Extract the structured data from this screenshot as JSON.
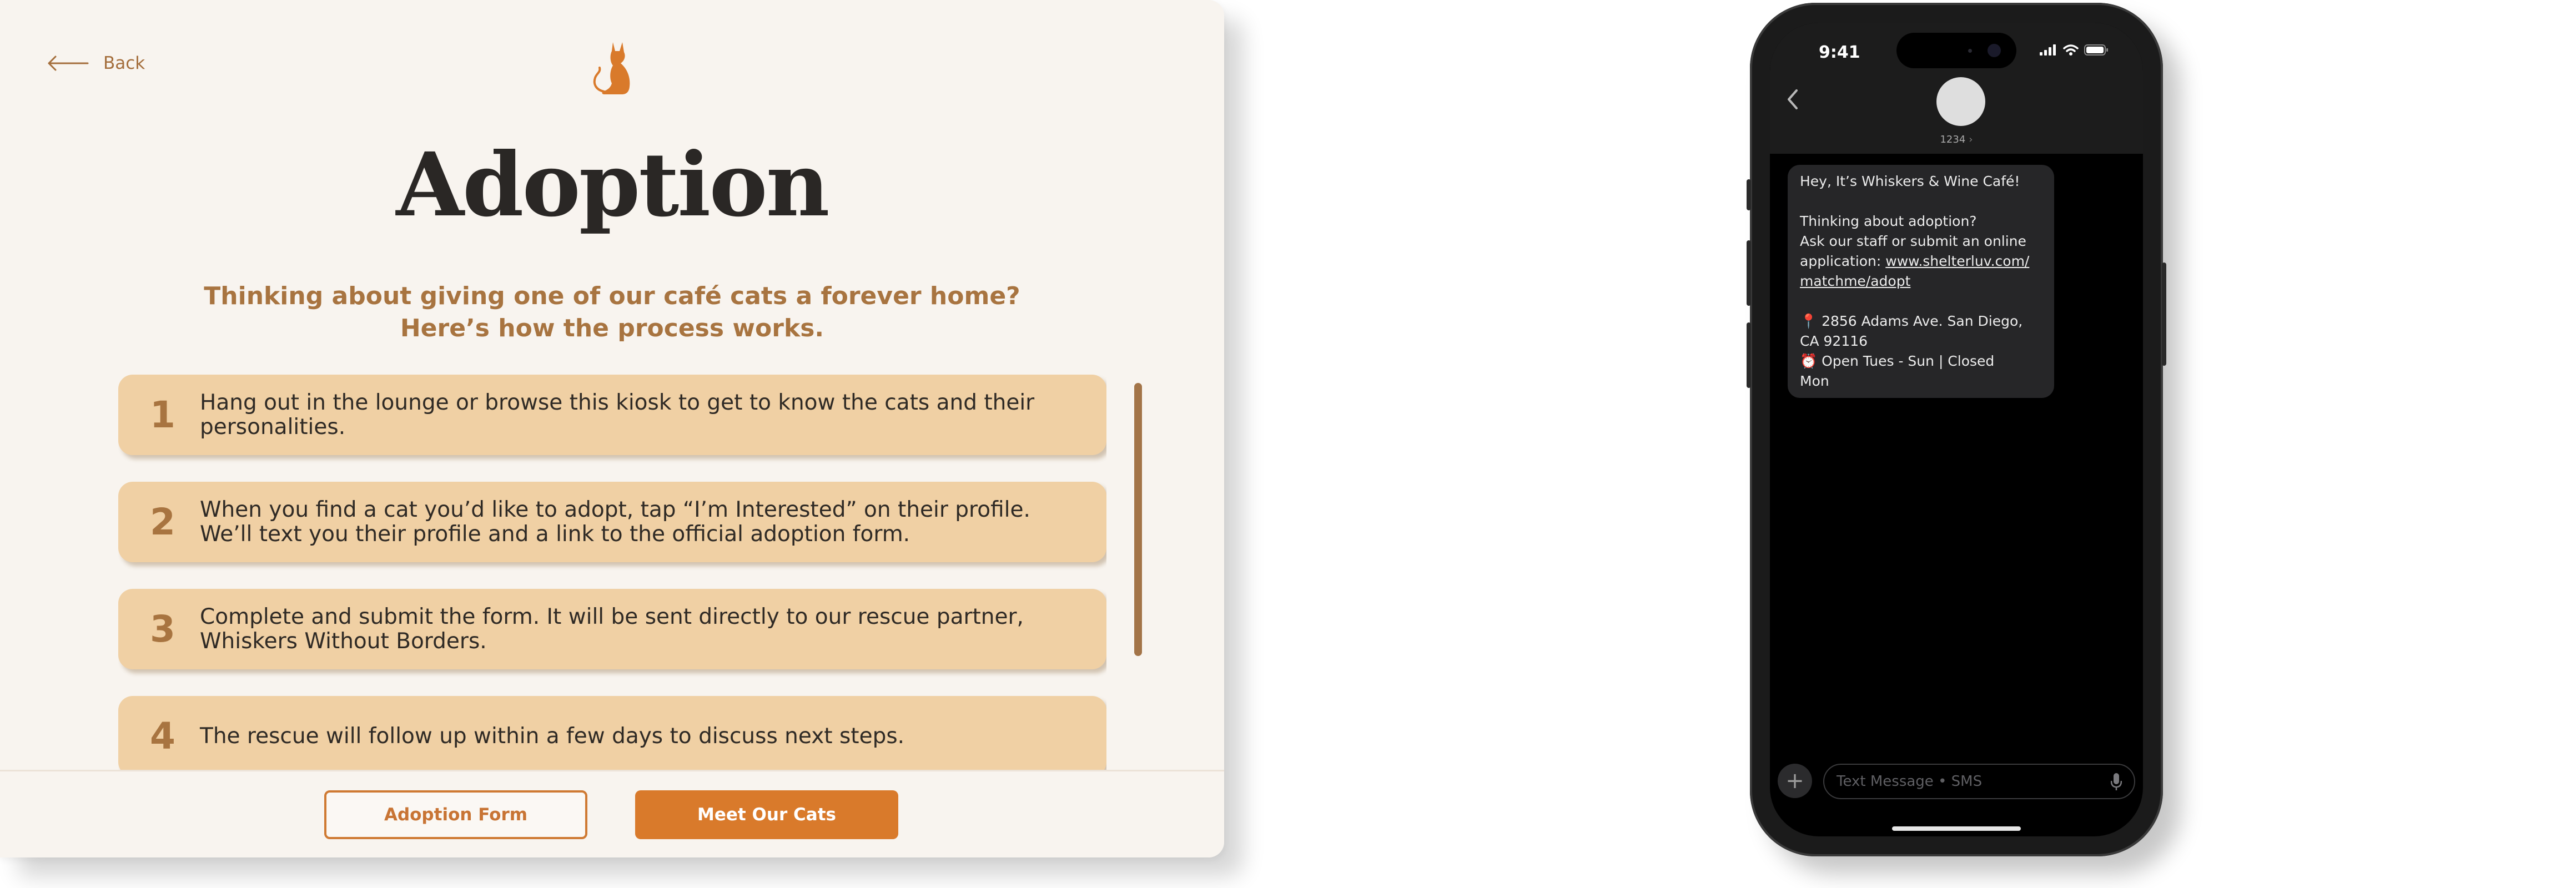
{
  "kiosk": {
    "back_label": "Back",
    "title": "Adoption",
    "subtitle_line1": "Thinking about giving one of our café cats a forever home?",
    "subtitle_line2": "Here’s how the process works.",
    "steps": [
      {
        "number": "1",
        "text": "Hang out in the lounge or browse this kiosk to get to know the cats and their personalities."
      },
      {
        "number": "2",
        "text": "When you find a cat you’d like to adopt, tap “I’m Interested” on their profile. We’ll text you their profile and a link to the official adoption form."
      },
      {
        "number": "3",
        "text": "Complete and submit the form. It will be sent directly to our rescue partner, Whiskers Without Borders."
      },
      {
        "number": "4",
        "text": "The rescue will follow up within a few days to discuss next steps."
      }
    ],
    "buttons": {
      "adoption_form": "Adoption Form",
      "meet_cats": "Meet Our Cats"
    },
    "icons": {
      "back": "arrow-left-icon",
      "logo": "cat-logo-icon"
    },
    "colors": {
      "background": "#f8f4ef",
      "card": "#f0d0a4",
      "accent": "#d97a2b",
      "subtitle": "#a87440",
      "title": "#2a2725"
    }
  },
  "phone": {
    "status_time": "9:41",
    "contact_name": "1234",
    "contact_chevron": "›",
    "message": {
      "line1": "Hey, It’s Whiskers & Wine Café!",
      "line2": "Thinking about adoption?",
      "line3": "Ask our staff or submit an online",
      "line4_prefix": "application: ",
      "link_part1": "www.shelterluv.com/",
      "link_part2": "matchme/adopt",
      "address_line1": "📍 2856 Adams Ave. San Diego,",
      "address_line2": "CA 92116",
      "hours_line1": "⏰ Open Tues - Sun | Closed",
      "hours_line2": "Mon"
    },
    "compose_placeholder": "Text Message • SMS",
    "compose_plus": "+",
    "icons": {
      "back": "chevron-left-icon",
      "signal": "signal-icon",
      "wifi": "wifi-icon",
      "battery": "battery-icon",
      "mic": "microphone-icon",
      "avatar": "contact-avatar"
    }
  }
}
